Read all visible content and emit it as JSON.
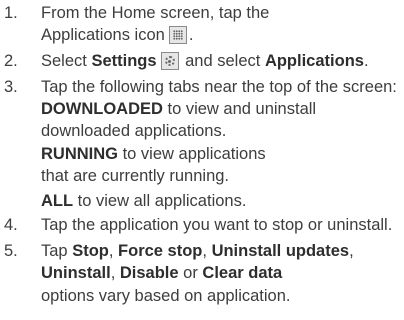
{
  "steps": [
    {
      "number": "1.",
      "line1": "From the Home screen, tap the",
      "line2_pre": "Applications icon",
      "line2_post": "."
    },
    {
      "number": "2.",
      "pre": "Select ",
      "bold1": "Settings",
      "mid": " and select ",
      "bold2": "Applications",
      "post": "."
    },
    {
      "number": "3.",
      "line1": "Tap the following tabs near the top of the screen:",
      "tabs": [
        {
          "bold": "DOWNLOADED",
          "rest": " to view and uninstall",
          "cont": "downloaded applications."
        },
        {
          "bold": "RUNNING",
          "rest": " to view applications",
          "cont": "that are currently running."
        },
        {
          "bold": "ALL",
          "rest": " to view all applications."
        }
      ]
    },
    {
      "number": "4.",
      "line1": "Tap the application you want to stop or uninstall."
    },
    {
      "number": "5.",
      "pre": "Tap ",
      "b1": "Stop",
      "s1": ", ",
      "b2": "Force stop",
      "s2": ", ",
      "b3": "Uninstall updates",
      "s3": ",",
      "b4": "Uninstall",
      "s4": ", ",
      "b5": "Disable",
      "s5": " or ",
      "b6": "Clear data",
      "line3": "options vary based on application."
    }
  ],
  "icons": {
    "applications": "apps-grid-icon",
    "settings": "gear-icon"
  }
}
